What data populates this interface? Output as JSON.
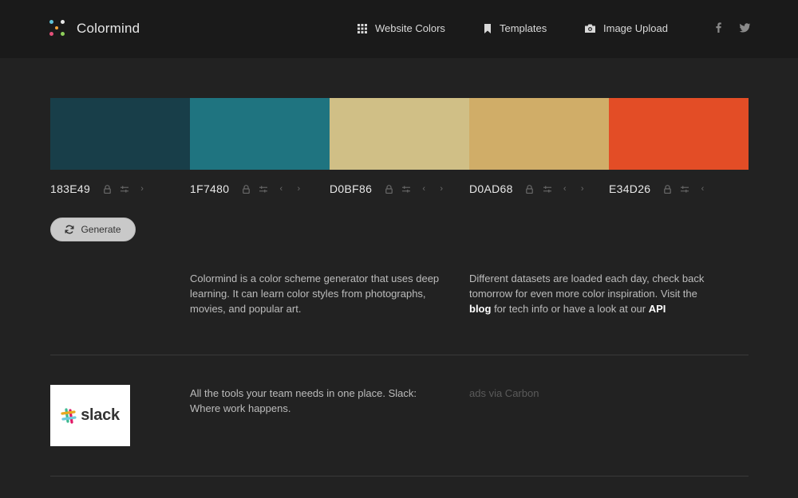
{
  "header": {
    "app_name": "Colormind",
    "nav": [
      {
        "label": "Website Colors",
        "icon": "grid-icon"
      },
      {
        "label": "Templates",
        "icon": "bookmark-icon"
      },
      {
        "label": "Image Upload",
        "icon": "camera-icon"
      }
    ],
    "social": [
      "facebook-icon",
      "twitter-icon"
    ]
  },
  "palette": [
    {
      "hex": "183E49",
      "color": "#183E49"
    },
    {
      "hex": "1F7480",
      "color": "#1F7480"
    },
    {
      "hex": "D0BF86",
      "color": "#D0BF86"
    },
    {
      "hex": "D0AD68",
      "color": "#D0AD68"
    },
    {
      "hex": "E34D26",
      "color": "#E34D26"
    }
  ],
  "generate_label": "Generate",
  "about": {
    "left": "Colormind is a color scheme generator that uses deep learning. It can learn color styles from photographs, movies, and popular art.",
    "right_pre": "Different datasets are loaded each day, check back tomorrow for even more color inspiration. Visit the",
    "blog_link": "blog",
    "right_mid": "for tech info or have a look at our",
    "api_link": "API"
  },
  "ad": {
    "brand": "slack",
    "text": "All the tools your team needs in one place. Slack: Where work happens.",
    "via": "ads via Carbon"
  }
}
